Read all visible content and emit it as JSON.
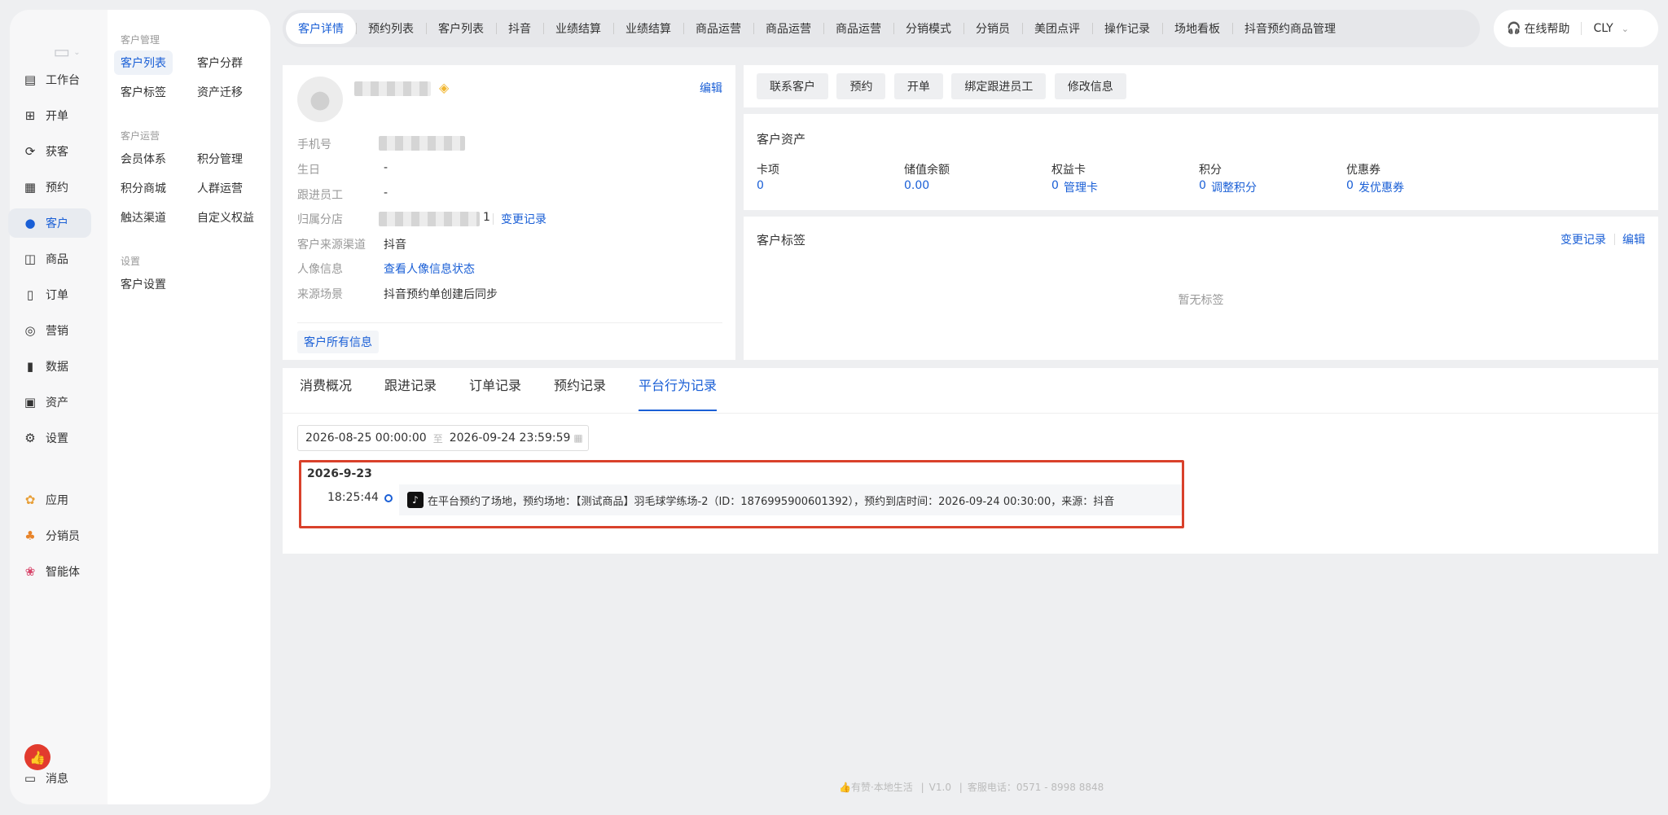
{
  "nav": {
    "items": [
      {
        "icon": "workbench-icon",
        "label": "工作台"
      },
      {
        "icon": "open-order-icon",
        "label": "开单"
      },
      {
        "icon": "acquire-icon",
        "label": "获客"
      },
      {
        "icon": "calendar-icon",
        "label": "预约"
      },
      {
        "icon": "user-icon",
        "label": "客户"
      },
      {
        "icon": "bag-icon",
        "label": "商品"
      },
      {
        "icon": "order-icon",
        "label": "订单"
      },
      {
        "icon": "target-icon",
        "label": "营销"
      },
      {
        "icon": "bar-chart-icon",
        "label": "数据"
      },
      {
        "icon": "asset-icon",
        "label": "资产"
      },
      {
        "icon": "gear-icon",
        "label": "设置"
      },
      {
        "icon": "apps-icon",
        "label": "应用"
      },
      {
        "icon": "distributor-icon",
        "label": "分销员"
      },
      {
        "icon": "agent-icon",
        "label": "智能体"
      },
      {
        "icon": "message-icon",
        "label": "消息"
      }
    ]
  },
  "sub": {
    "group1": "客户管理",
    "group2": "客户运营",
    "group3": "设置",
    "items": [
      "客户列表",
      "客户分群",
      "客户标签",
      "资产迁移",
      "会员体系",
      "积分管理",
      "积分商城",
      "人群运营",
      "触达渠道",
      "自定义权益",
      "客户设置"
    ]
  },
  "tabs": [
    "客户详情",
    "预约列表",
    "客户列表",
    "抖音",
    "业绩结算",
    "业绩结算",
    "商品运营",
    "商品运营",
    "商品运营",
    "分销模式",
    "分销员",
    "美团点评",
    "操作记录",
    "场地看板",
    "抖音预约商品管理"
  ],
  "topright": {
    "help": "在线帮助",
    "user": "CLY"
  },
  "profile": {
    "edit": "编辑",
    "fields": [
      {
        "label": "手机号",
        "value": ""
      },
      {
        "label": "生日",
        "value": "-"
      },
      {
        "label": "跟进员工",
        "value": "-"
      },
      {
        "label": "归属分店",
        "value": "1"
      },
      {
        "label": "客户来源渠道",
        "value": "抖音"
      },
      {
        "label": "人像信息",
        "value": "查看人像信息状态"
      },
      {
        "label": "来源场景",
        "value": "抖音预约单创建后同步"
      }
    ],
    "change_record": "变更记录",
    "all_info": "客户所有信息"
  },
  "actions": [
    "联系客户",
    "预约",
    "开单",
    "绑定跟进员工",
    "修改信息"
  ],
  "assets": {
    "title": "客户资产",
    "items": [
      {
        "label": "卡项",
        "value": "0",
        "link": ""
      },
      {
        "label": "储值余额",
        "value": "0.00",
        "link": ""
      },
      {
        "label": "权益卡",
        "value": "0",
        "link": "管理卡"
      },
      {
        "label": "积分",
        "value": "0",
        "link": "调整积分"
      },
      {
        "label": "优惠券",
        "value": "0",
        "link": "发优惠券"
      }
    ]
  },
  "tags": {
    "title": "客户标签",
    "change_record": "变更记录",
    "edit": "编辑",
    "empty": "暂无标签"
  },
  "detail_tabs": [
    "消费概况",
    "跟进记录",
    "订单记录",
    "预约记录",
    "平台行为记录"
  ],
  "daterange": {
    "start": "2026-08-25 00:00:00",
    "sep": "至",
    "end": "2026-09-24 23:59:59"
  },
  "record": {
    "date": "2026-9-23",
    "time": "18:25:44",
    "text": "在平台预约了场地，预约场地：【测试商品】羽毛球学练场-2（ID：1876995900601392），预约到店时间：2026-09-24 00:30:00，来源：抖音"
  },
  "footer": {
    "brand": "有赞·本地生活",
    "version": "V1.0",
    "phone_label": "客服电话：",
    "phone": "0571 - 8998 8848"
  },
  "colors": {
    "accent": "#1a5fd6",
    "highlight_border": "#d9412b",
    "brand_red": "#e23b2e"
  }
}
